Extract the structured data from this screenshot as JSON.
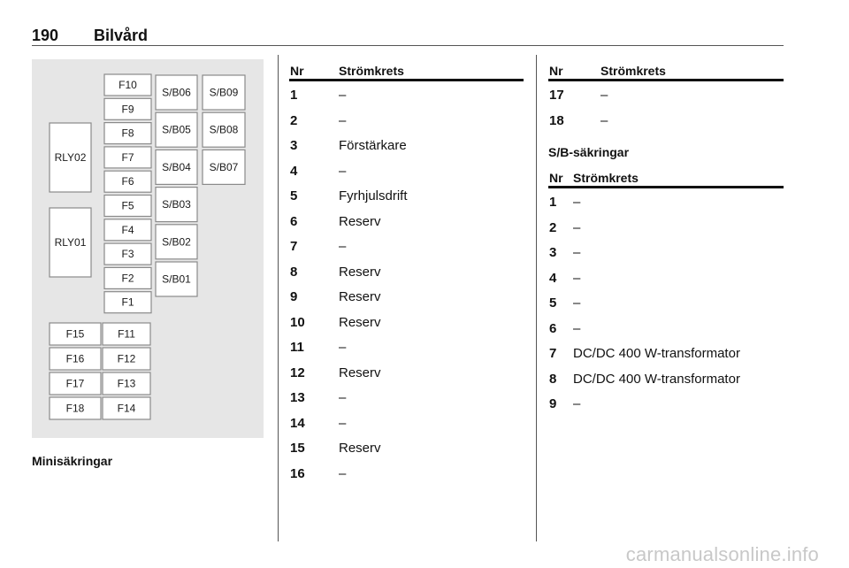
{
  "header": {
    "page_number": "190",
    "title": "Bilvård"
  },
  "diagram": {
    "caption": "Minisäkringar",
    "relays": [
      "RLY02",
      "RLY01"
    ],
    "fuses_column": [
      "F10",
      "F9",
      "F8",
      "F7",
      "F6",
      "F5",
      "F4",
      "F3",
      "F2",
      "F1"
    ],
    "fuses_left": [
      "F15",
      "F16",
      "F17",
      "F18"
    ],
    "fuses_right": [
      "F11",
      "F12",
      "F13",
      "F14"
    ],
    "sb_col1": [
      "S/B06",
      "S/B05",
      "S/B04",
      "S/B03",
      "S/B02",
      "S/B01"
    ],
    "sb_col2": [
      "S/B09",
      "S/B08",
      "S/B07"
    ]
  },
  "fuse_table": {
    "col_nr": "Nr",
    "col_circuit": "Strömkrets",
    "rows": [
      {
        "nr": "1",
        "circuit": "–"
      },
      {
        "nr": "2",
        "circuit": "–"
      },
      {
        "nr": "3",
        "circuit": "Förstärkare"
      },
      {
        "nr": "4",
        "circuit": "–"
      },
      {
        "nr": "5",
        "circuit": "Fyrhjulsdrift"
      },
      {
        "nr": "6",
        "circuit": "Reserv"
      },
      {
        "nr": "7",
        "circuit": "–"
      },
      {
        "nr": "8",
        "circuit": "Reserv"
      },
      {
        "nr": "9",
        "circuit": "Reserv"
      },
      {
        "nr": "10",
        "circuit": "Reserv"
      },
      {
        "nr": "11",
        "circuit": "–"
      },
      {
        "nr": "12",
        "circuit": "Reserv"
      },
      {
        "nr": "13",
        "circuit": "–"
      },
      {
        "nr": "14",
        "circuit": "–"
      },
      {
        "nr": "15",
        "circuit": "Reserv"
      },
      {
        "nr": "16",
        "circuit": "–"
      }
    ]
  },
  "fuse_table_cont": {
    "col_nr": "Nr",
    "col_circuit": "Strömkrets",
    "rows": [
      {
        "nr": "17",
        "circuit": "–"
      },
      {
        "nr": "18",
        "circuit": "–"
      }
    ]
  },
  "sb_section": {
    "heading": "S/B-säkringar",
    "col_nr": "Nr",
    "col_circuit": "Strömkrets",
    "rows": [
      {
        "nr": "1",
        "circuit": "–"
      },
      {
        "nr": "2",
        "circuit": "–"
      },
      {
        "nr": "3",
        "circuit": "–"
      },
      {
        "nr": "4",
        "circuit": "–"
      },
      {
        "nr": "5",
        "circuit": "–"
      },
      {
        "nr": "6",
        "circuit": "–"
      },
      {
        "nr": "7",
        "circuit": "DC/DC 400 W-transformator"
      },
      {
        "nr": "8",
        "circuit": "DC/DC 400 W-transformator"
      },
      {
        "nr": "9",
        "circuit": "–"
      }
    ]
  },
  "watermark": "carmanualsonline.info"
}
